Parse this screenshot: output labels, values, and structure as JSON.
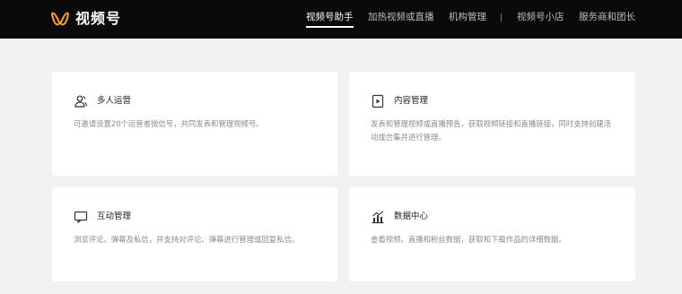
{
  "brand": {
    "name": "视频号",
    "icon": "channels-logo-icon",
    "accent": "#fa9d3b"
  },
  "nav": {
    "items": [
      {
        "label": "视频号助手",
        "active": true
      },
      {
        "label": "加热视频或直播",
        "active": false
      },
      {
        "label": "机构管理",
        "active": false
      },
      {
        "label": "视频号小店",
        "active": false
      },
      {
        "label": "服务商和团长",
        "active": false
      }
    ]
  },
  "cards": [
    {
      "title": "多人运营",
      "icon": "users-icon",
      "desc": "可邀请设置20个运营者微信号，共同发表和管理视频号。"
    },
    {
      "title": "内容管理",
      "icon": "play-document-icon",
      "desc": "发表和管理视频或直播预告，获取视频链接和直播链接，同时支持创建活动或合集并进行管理。"
    },
    {
      "title": "互动管理",
      "icon": "message-icon",
      "desc": "浏览评论、弹幕及私信，并支持对评论、弹幕进行管理或回复私信。"
    },
    {
      "title": "数据中心",
      "icon": "chart-icon",
      "desc": "查看视频、直播和粉丝数据，获取和下载作品的详细数据。"
    }
  ],
  "colors": {
    "topbar": "#0a0a0a",
    "background": "#f2f2f2",
    "card": "#ffffff",
    "muted_text": "#8a8a8a"
  }
}
